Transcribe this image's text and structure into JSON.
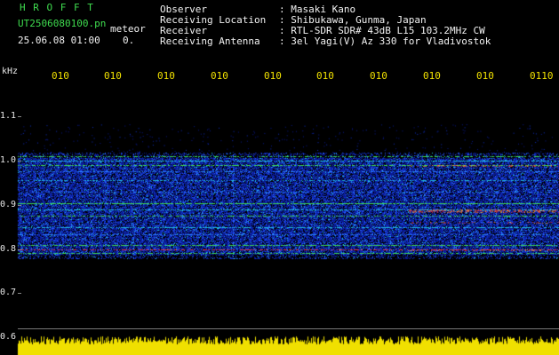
{
  "header": {
    "title": "H R O F F T",
    "file_name": "UT2506080100.pn",
    "mode": "meteor",
    "datetime": "25.06.08 01:00",
    "extra": "0.",
    "info_labels": [
      "Observer",
      "Receiving Location",
      "Receiver",
      "Receiving Antenna"
    ],
    "info_values": [
      ": Masaki Kano",
      ": Shibukawa, Gunma, Japan",
      ": RTL-SDR SDR# 43dB L15 103.2MHz CW",
      ": 3el Yagi(V) Az 330 for Vladivostok"
    ]
  },
  "axis": {
    "unit": "kHz",
    "y_ticks": [
      "1.1",
      "1.0",
      "0.9",
      "0.8",
      "0.7",
      "0.6"
    ],
    "time_labels": [
      "010",
      "010",
      "010",
      "010",
      "010",
      "010",
      "010",
      "010",
      "010",
      "0110"
    ]
  },
  "colors": {
    "background": "#000000",
    "noise": "#0a1aa0",
    "signal_green": "#3fdc4f",
    "signal_red": "#e0303a",
    "amplitude_yellow": "#f0e000"
  }
}
